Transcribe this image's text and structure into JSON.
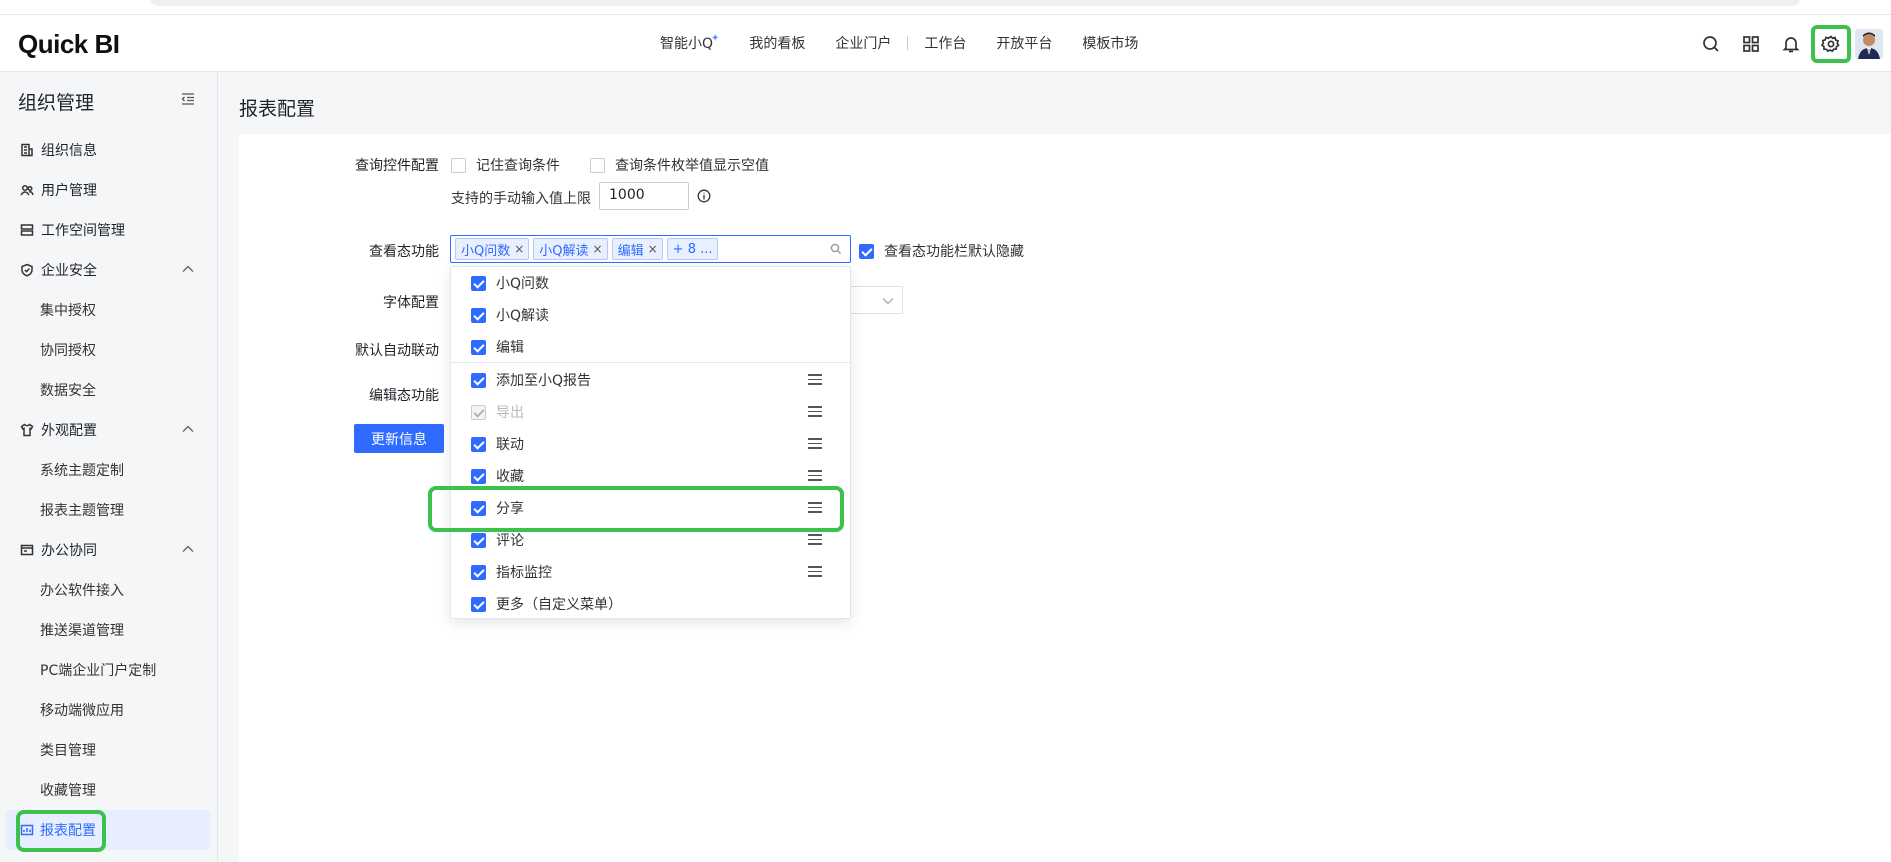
{
  "app": {
    "logo": "Quick BI"
  },
  "topnav": {
    "items": [
      "智能小Q",
      "我的看板",
      "企业门户",
      "工作台",
      "开放平台",
      "模板市场"
    ]
  },
  "sidebar": {
    "title": "组织管理",
    "items": [
      {
        "label": "组织信息",
        "icon": "org-info-icon"
      },
      {
        "label": "用户管理",
        "icon": "users-icon"
      },
      {
        "label": "工作空间管理",
        "icon": "workspace-icon"
      },
      {
        "label": "企业安全",
        "icon": "shield-icon"
      },
      {
        "label": "集中授权"
      },
      {
        "label": "协同授权"
      },
      {
        "label": "数据安全"
      },
      {
        "label": "外观配置",
        "icon": "shirt-icon"
      },
      {
        "label": "系统主题定制"
      },
      {
        "label": "报表主题管理"
      },
      {
        "label": "办公协同",
        "icon": "office-icon"
      },
      {
        "label": "办公软件接入"
      },
      {
        "label": "推送渠道管理"
      },
      {
        "label": "PC端企业门户定制"
      },
      {
        "label": "移动端微应用"
      },
      {
        "label": "类目管理"
      },
      {
        "label": "收藏管理"
      },
      {
        "label": "报表配置",
        "icon": "report-icon"
      }
    ]
  },
  "main": {
    "page_title": "报表配置",
    "query_control": {
      "label": "查询控件配置",
      "remember": "记住查询条件",
      "show_empty": "查询条件枚举值显示空值",
      "manual_limit_label": "支持的手动输入值上限",
      "manual_limit_value": "1000"
    },
    "view_mode": {
      "label": "查看态功能",
      "tags": [
        "小Q问数",
        "小Q解读",
        "编辑",
        "+ 8 ..."
      ],
      "hide_label": "查看态功能栏默认隐藏"
    },
    "font_label": "字体配置",
    "auto_link_label": "默认自动联动",
    "edit_mode_label": "编辑态功能",
    "update_button": "更新信息"
  },
  "dropdown": {
    "items": [
      {
        "label": "小Q问数",
        "checked": true
      },
      {
        "label": "小Q解读",
        "checked": true
      },
      {
        "label": "编辑",
        "checked": true
      },
      {
        "label": "添加至小Q报告",
        "checked": true
      },
      {
        "label": "导出",
        "checked": true,
        "disabled": true
      },
      {
        "label": "联动",
        "checked": true
      },
      {
        "label": "收藏",
        "checked": true
      },
      {
        "label": "分享",
        "checked": true
      },
      {
        "label": "评论",
        "checked": true
      },
      {
        "label": "指标监控",
        "checked": true
      },
      {
        "label": "更多（自定义菜单）",
        "checked": true
      }
    ]
  },
  "colors": {
    "primary": "#2f6bff",
    "highlight": "#3cc14a"
  }
}
